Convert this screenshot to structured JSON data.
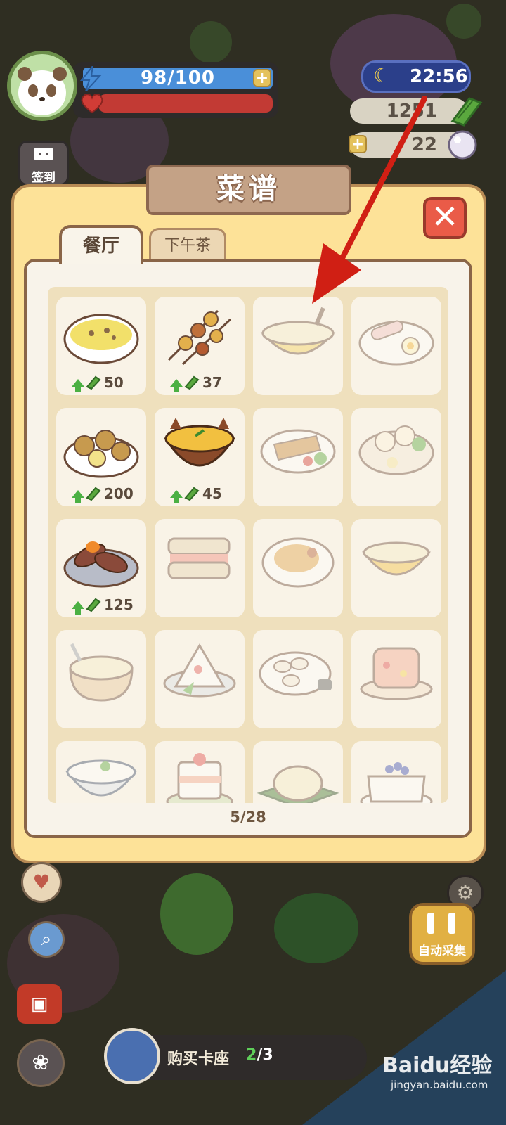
{
  "hud": {
    "energy": "98/100",
    "time": "22:56",
    "leaf_currency": "1251",
    "pearl_currency": "22",
    "checkin_label": "签到"
  },
  "modal": {
    "title": "菜谱",
    "tabs": [
      {
        "label": "餐厅",
        "active": true
      },
      {
        "label": "下午茶",
        "active": false
      }
    ],
    "progress": "5/28",
    "recipes": [
      {
        "name": "soup-bowl",
        "unlocked": true,
        "value": "50"
      },
      {
        "name": "skewers",
        "unlocked": true,
        "value": "37"
      },
      {
        "name": "noodle-soup",
        "unlocked": false
      },
      {
        "name": "meat-rolls-plate",
        "unlocked": false
      },
      {
        "name": "baked-potatoes",
        "unlocked": true,
        "value": "200"
      },
      {
        "name": "curry-pot",
        "unlocked": true,
        "value": "45"
      },
      {
        "name": "veggie-platter",
        "unlocked": false
      },
      {
        "name": "dumpling-platter",
        "unlocked": false
      },
      {
        "name": "roasted-sweet-potato",
        "unlocked": true,
        "value": "125"
      },
      {
        "name": "sandwich",
        "unlocked": false
      },
      {
        "name": "fried-rice-plate",
        "unlocked": false
      },
      {
        "name": "custard-bowl",
        "unlocked": false
      },
      {
        "name": "porridge-bowl",
        "unlocked": false
      },
      {
        "name": "rice-ball",
        "unlocked": false
      },
      {
        "name": "dumplings",
        "unlocked": false
      },
      {
        "name": "fruit-jelly",
        "unlocked": false
      },
      {
        "name": "rice-bowl",
        "unlocked": false
      },
      {
        "name": "layer-cake",
        "unlocked": false
      },
      {
        "name": "pancake",
        "unlocked": false
      },
      {
        "name": "berry-pudding",
        "unlocked": false
      }
    ]
  },
  "bottom": {
    "buy_label": "购买卡座",
    "buy_current": "2",
    "buy_total": "/3",
    "auto_label": "自动采集"
  },
  "watermark": {
    "brand": "Baidu经验",
    "url": "jingyan.baidu.com"
  },
  "colors": {
    "modal_bg": "#fde298",
    "panel_bg": "#f8f3ea",
    "close": "#ea5b48",
    "arrow": "#d01f14"
  }
}
